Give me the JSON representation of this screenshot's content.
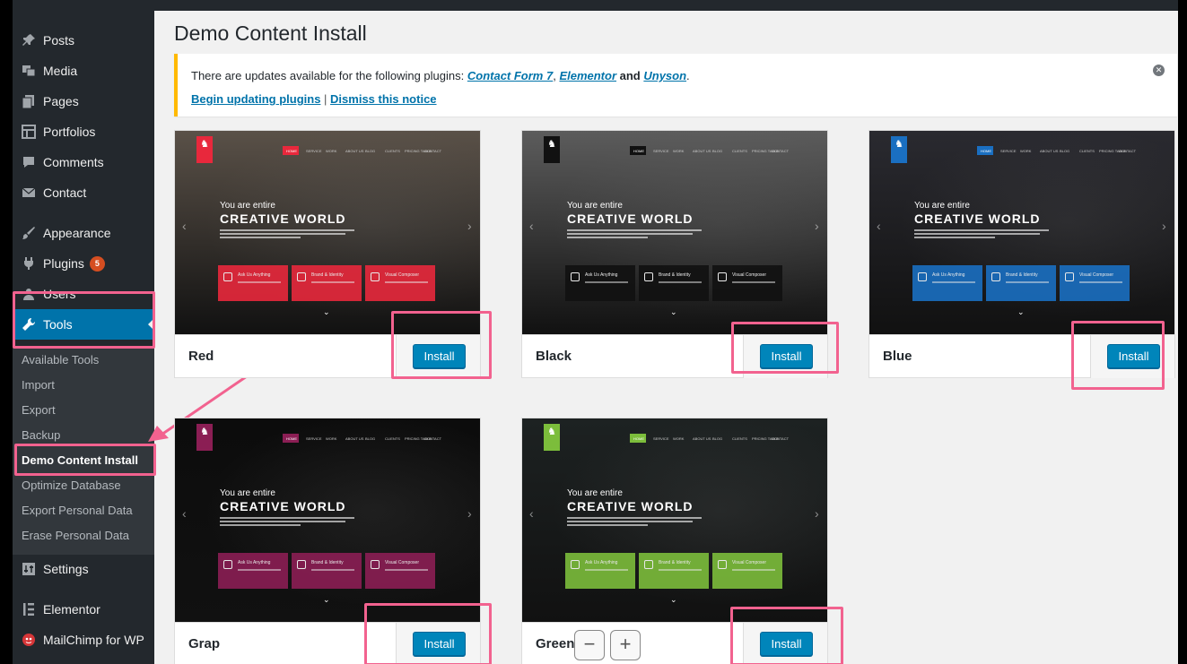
{
  "sidebar": {
    "items": [
      {
        "label": "Posts",
        "icon": "pin-icon"
      },
      {
        "label": "Media",
        "icon": "media-icon"
      },
      {
        "label": "Pages",
        "icon": "pages-icon"
      },
      {
        "label": "Portfolios",
        "icon": "portfolio-icon"
      },
      {
        "label": "Comments",
        "icon": "comment-icon"
      },
      {
        "label": "Contact",
        "icon": "mail-icon"
      },
      {
        "label": "Appearance",
        "icon": "brush-icon"
      },
      {
        "label": "Plugins",
        "icon": "plugin-icon",
        "badge": "5"
      },
      {
        "label": "Users",
        "icon": "users-icon"
      },
      {
        "label": "Tools",
        "icon": "wrench-icon"
      },
      {
        "label": "Settings",
        "icon": "settings-icon"
      },
      {
        "label": "Elementor",
        "icon": "elementor-icon"
      },
      {
        "label": "MailChimp for WP",
        "icon": "mailchimp-icon"
      }
    ],
    "submenu": [
      "Available Tools",
      "Import",
      "Export",
      "Backup",
      "Demo Content Install",
      "Optimize Database",
      "Export Personal Data",
      "Erase Personal Data"
    ],
    "active_item": "Tools",
    "current_submenu": "Demo Content Install"
  },
  "page": {
    "title": "Demo Content Install"
  },
  "notice": {
    "prefix": "There are updates available for the following plugins: ",
    "plugins": [
      "Contact Form 7",
      "Elementor",
      "Unyson"
    ],
    "sep1": ", ",
    "sep2": " and ",
    "suffix": ".",
    "begin_link": "Begin updating plugins",
    "divider": " | ",
    "dismiss_link": "Dismiss this notice"
  },
  "demos": [
    {
      "name": "Red",
      "accent": "#e8283c",
      "bg": "#5a5148",
      "button": "Install"
    },
    {
      "name": "Black",
      "accent": "#111111",
      "bg": "#5c5c5c",
      "button": "Install"
    },
    {
      "name": "Blue",
      "accent": "#1a6fc1",
      "bg": "#2a2a30",
      "button": "Install"
    },
    {
      "name": "Grap",
      "accent": "#8b1e54",
      "bg": "#0c0c0c",
      "button": "Install"
    },
    {
      "name": "Green",
      "accent": "#7cbd3b",
      "bg": "#1d2222",
      "button": "Install"
    }
  ],
  "thumbnail_text": {
    "tagline": "You are entire",
    "headline": "CREATIVE WORLD",
    "features": [
      "Ask Us Anything",
      "Brand & Identity",
      "Visual Composer"
    ],
    "nav": [
      "HOME",
      "SERVICE",
      "WORK",
      "ABOUT US",
      "BLOG",
      "CLIENTS",
      "PRICING TABLE",
      "CONTACT"
    ]
  },
  "zoom": {
    "minus": "−",
    "plus": "+"
  },
  "colors": {
    "highlight": "#f2628f",
    "wp_blue": "#0073aa",
    "notice_warning": "#ffb900"
  }
}
